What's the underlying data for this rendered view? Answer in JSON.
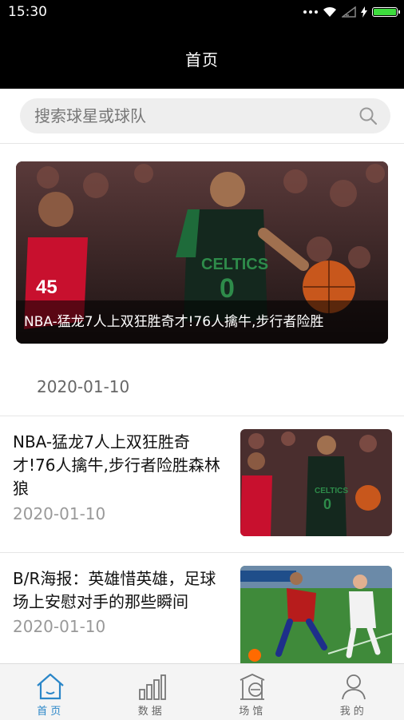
{
  "status": {
    "time": "15:30"
  },
  "header": {
    "title": "首页"
  },
  "search": {
    "placeholder": "搜索球星或球队"
  },
  "feature": {
    "caption": "NBA-猛龙7人上双狂胜奇才!76人擒牛,步行者险胜",
    "date": "2020-01-10"
  },
  "news": [
    {
      "title": "NBA-猛龙7人上双狂胜奇才!76人擒牛,步行者险胜森林狼",
      "date": "2020-01-10"
    },
    {
      "title": "B/R海报：英雄惜英雄，足球场上安慰对手的那些瞬间",
      "date": "2020-01-10"
    }
  ],
  "tabs": [
    {
      "label": "首页",
      "icon": "home-icon",
      "active": true
    },
    {
      "label": "数据",
      "icon": "bar-chart-icon",
      "active": false
    },
    {
      "label": "场馆",
      "icon": "stadium-icon",
      "active": false
    },
    {
      "label": "我的",
      "icon": "user-icon",
      "active": false
    }
  ],
  "colors": {
    "accent": "#2a86c8",
    "header": "#000000"
  }
}
